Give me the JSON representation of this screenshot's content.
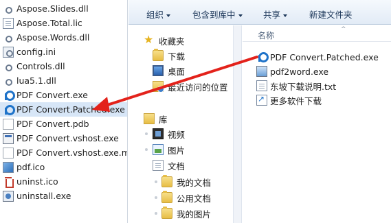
{
  "left_list": {
    "files": [
      {
        "name": "Aspose.Slides.dll",
        "icon": "dll-gear-icon"
      },
      {
        "name": "Aspose.Total.lic",
        "icon": "document-icon"
      },
      {
        "name": "Aspose.Words.dll",
        "icon": "dll-gear-icon"
      },
      {
        "name": "config.ini",
        "icon": "settings-file-icon"
      },
      {
        "name": "Controls.dll",
        "icon": "dll-gear-icon"
      },
      {
        "name": "lua5.1.dll",
        "icon": "dll-gear-icon"
      },
      {
        "name": "PDF Convert.exe",
        "icon": "pdf-app-icon"
      },
      {
        "name": "PDF Convert.Patched.exe",
        "icon": "pdf-app-icon",
        "selected": true
      },
      {
        "name": "PDF Convert.pdb",
        "icon": "blank-file-icon"
      },
      {
        "name": "PDF Convert.vshost.exe",
        "icon": "app-window-icon"
      },
      {
        "name": "PDF Convert.vshost.exe.manifest",
        "icon": "blank-file-icon"
      },
      {
        "name": "pdf.ico",
        "icon": "image-icon"
      },
      {
        "name": "uninst.ico",
        "icon": "trash-icon"
      },
      {
        "name": "uninstall.exe",
        "icon": "installer-icon"
      }
    ]
  },
  "toolbar": {
    "organize": "组织",
    "include_in_library": "包含到库中",
    "share": "共享",
    "new_folder": "新建文件夹"
  },
  "nav": {
    "favorites": "收藏夹",
    "downloads": "下载",
    "desktop": "桌面",
    "recent": "最近访问的位置",
    "libraries": "库",
    "videos": "视频",
    "pictures": "图片",
    "documents": "文档",
    "my_documents": "我的文档",
    "public_documents": "公用文档",
    "my_pictures": "我的图片"
  },
  "content": {
    "column_name": "名称",
    "files": [
      {
        "name": "PDF Convert.Patched.exe",
        "icon": "pdf-app-icon"
      },
      {
        "name": "pdf2word.exe",
        "icon": "app-icon"
      },
      {
        "name": "东坡下载说明.txt",
        "icon": "text-file-icon"
      },
      {
        "name": "更多软件下载",
        "icon": "shortcut-icon"
      }
    ]
  },
  "colors": {
    "selection": "#d7e6f7",
    "arrow": "#e3221b",
    "toolbar_text": "#1e395b"
  }
}
